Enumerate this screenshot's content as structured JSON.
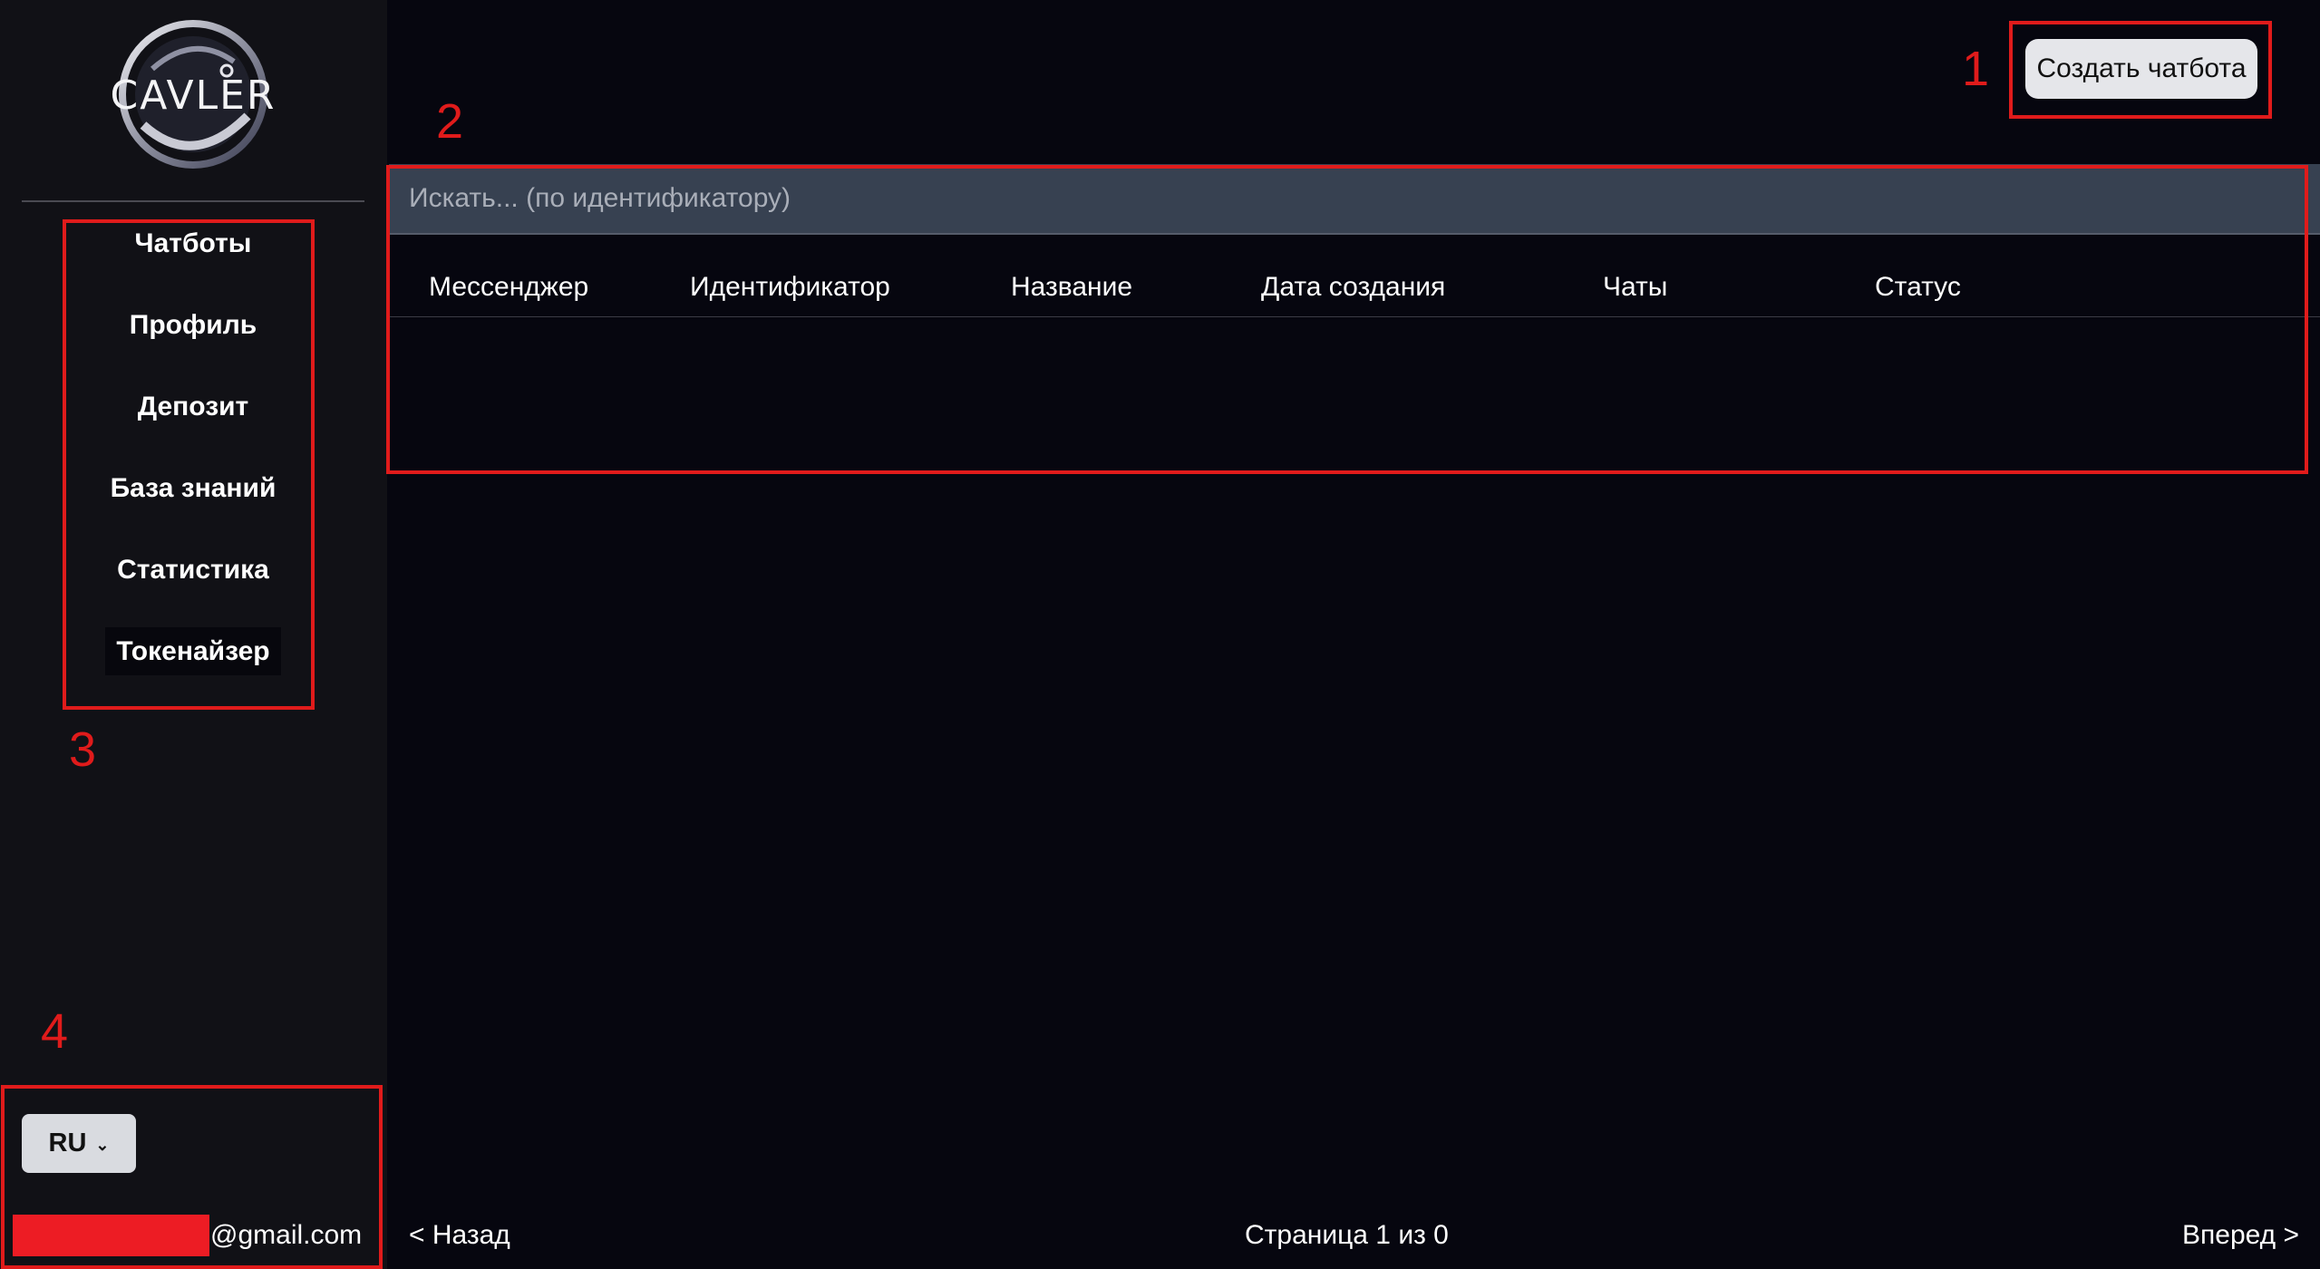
{
  "app": {
    "logo_text": "CAVLER"
  },
  "sidebar": {
    "items": [
      {
        "label": "Чатботы"
      },
      {
        "label": "Профиль"
      },
      {
        "label": "Депозит"
      },
      {
        "label": "База знаний"
      },
      {
        "label": "Статистика"
      },
      {
        "label": "Токенайзер"
      }
    ],
    "language": {
      "selected": "RU"
    },
    "user_email_suffix": "@gmail.com"
  },
  "header": {
    "create_button_label": "Создать чатбота"
  },
  "search": {
    "placeholder": "Искать... (по идентификатору)"
  },
  "table": {
    "columns": [
      "Мессенджер",
      "Идентификатор",
      "Название",
      "Дата создания",
      "Чаты",
      "Статус"
    ],
    "rows": []
  },
  "pagination": {
    "prev_label": "< Назад",
    "status": "Страница 1 из 0",
    "next_label": "Вперед >"
  },
  "annotations": {
    "labels": [
      "1",
      "2",
      "3",
      "4"
    ],
    "color": "#e01b1b"
  },
  "colors": {
    "background": "#06060f",
    "sidebar": "#111116",
    "search_bar": "#374151",
    "button": "#e5e6ea"
  }
}
